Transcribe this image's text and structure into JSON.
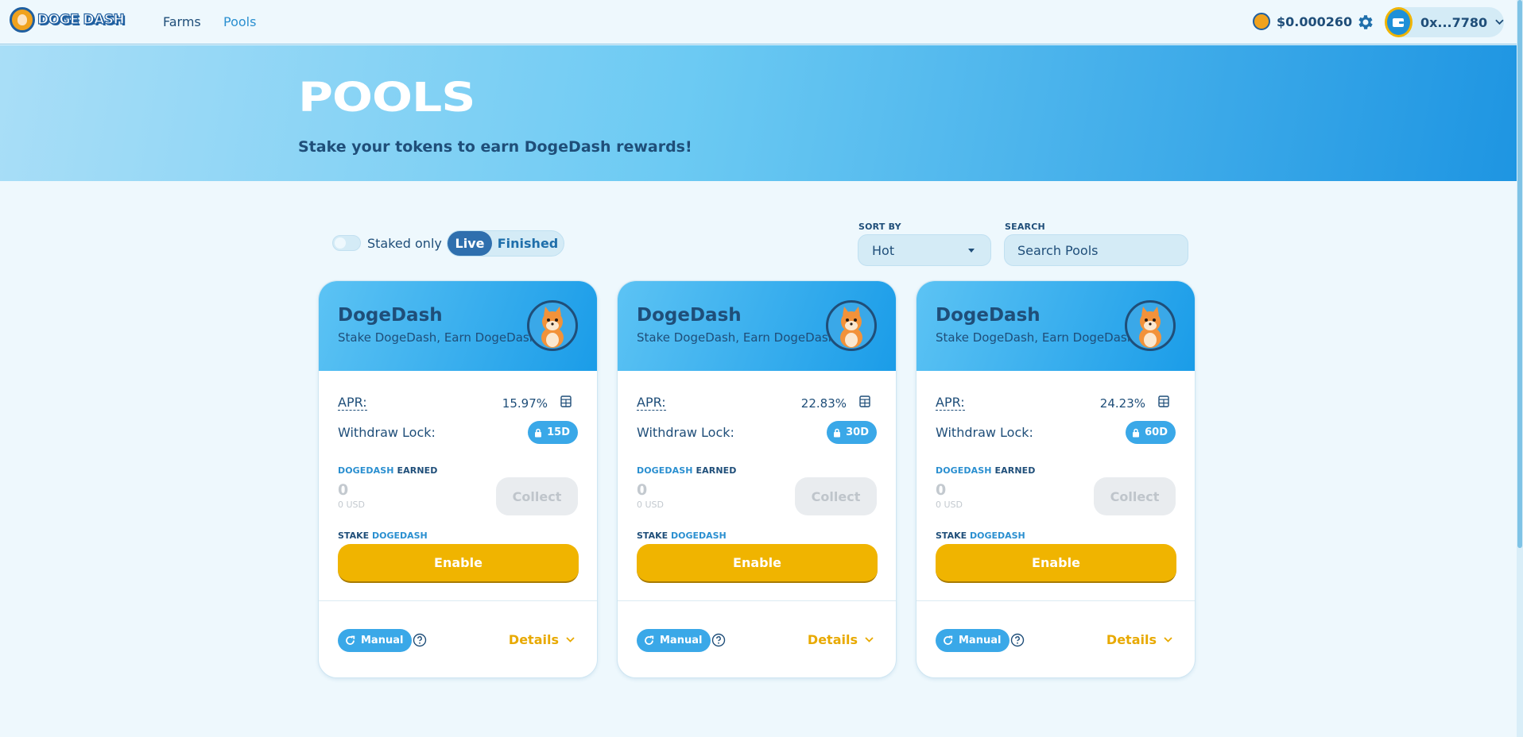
{
  "header": {
    "logo_text": "DOGE DASH",
    "nav": [
      {
        "label": "Farms"
      },
      {
        "label": "Pools"
      }
    ],
    "price": "$0.000260",
    "wallet": "0x...7780",
    "icons": [
      "doge-coin-icon",
      "gear-icon",
      "wallet-icon",
      "chevron-down-icon"
    ]
  },
  "hero": {
    "title": "POOLS",
    "subtitle": "Stake your tokens to earn DogeDash rewards!"
  },
  "filters": {
    "staked_only": "Staked only",
    "staked_only_on": false,
    "tabs": [
      "Live",
      "Finished"
    ],
    "active_tab": "Live",
    "sort_label": "SORT BY",
    "sort_value": "Hot",
    "search_label": "SEARCH",
    "search_placeholder": "Search Pools",
    "search_value": ""
  },
  "pools": [
    {
      "title": "DogeDash",
      "subtitle": "Stake DogeDash, Earn DogeDash",
      "apr_label": "APR:",
      "apr": "15.97%",
      "lock_label": "Withdraw Lock:",
      "lock": "15D",
      "earned_token": "DOGEDASH",
      "earned_word": "EARNED",
      "earned": "0",
      "earned_usd": "0 USD",
      "collect": "Collect",
      "stake_word": "STAKE",
      "stake_token": "DOGEDASH",
      "enable": "Enable",
      "mode": "Manual",
      "details": "Details"
    },
    {
      "title": "DogeDash",
      "subtitle": "Stake DogeDash, Earn DogeDash",
      "apr_label": "APR:",
      "apr": "22.83%",
      "lock_label": "Withdraw Lock:",
      "lock": "30D",
      "earned_token": "DOGEDASH",
      "earned_word": "EARNED",
      "earned": "0",
      "earned_usd": "0 USD",
      "collect": "Collect",
      "stake_word": "STAKE",
      "stake_token": "DOGEDASH",
      "enable": "Enable",
      "mode": "Manual",
      "details": "Details"
    },
    {
      "title": "DogeDash",
      "subtitle": "Stake DogeDash, Earn DogeDash",
      "apr_label": "APR:",
      "apr": "24.23%",
      "lock_label": "Withdraw Lock:",
      "lock": "60D",
      "earned_token": "DOGEDASH",
      "earned_word": "EARNED",
      "earned": "0",
      "earned_usd": "0 USD",
      "collect": "Collect",
      "stake_word": "STAKE",
      "stake_token": "DOGEDASH",
      "enable": "Enable",
      "mode": "Manual",
      "details": "Details"
    }
  ],
  "colors": {
    "accent": "#2a8fd0",
    "navy": "#1f4e79",
    "button_yellow": "#f0b400",
    "badge_blue": "#3aa8e8"
  }
}
